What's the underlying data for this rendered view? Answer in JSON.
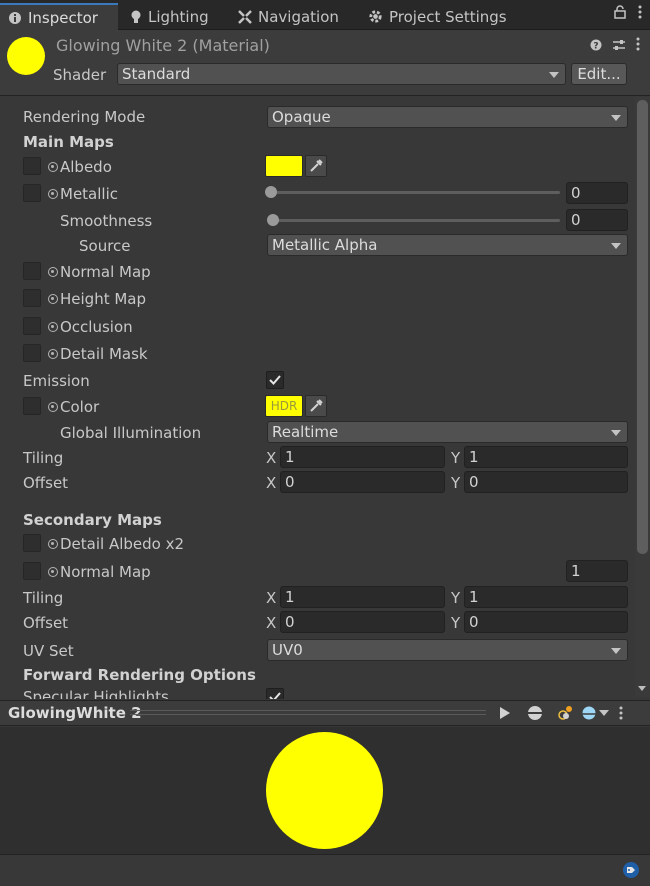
{
  "tabs": [
    {
      "label": "Inspector",
      "icon": "info-icon"
    },
    {
      "label": "Lighting",
      "icon": "bulb-icon"
    },
    {
      "label": "Navigation",
      "icon": "navigation-icon"
    },
    {
      "label": "Project Settings",
      "icon": "gear-icon"
    }
  ],
  "header": {
    "title": "Glowing White 2 (Material)",
    "shader_label": "Shader",
    "shader_value": "Standard",
    "edit_button": "Edit..."
  },
  "colors": {
    "albedo": "#ffff00",
    "emission": "#ffff00",
    "accent": "#3a79bb"
  },
  "props": {
    "rendering_mode_label": "Rendering Mode",
    "rendering_mode_value": "Opaque",
    "main_maps": "Main Maps",
    "albedo": "Albedo",
    "metallic": "Metallic",
    "metallic_value": "0",
    "smoothness": "Smoothness",
    "smoothness_value": "0",
    "source": "Source",
    "source_value": "Metallic Alpha",
    "normal_map": "Normal Map",
    "height_map": "Height Map",
    "occlusion": "Occlusion",
    "detail_mask": "Detail Mask",
    "emission": "Emission",
    "color": "Color",
    "hdr": "HDR",
    "global_illumination": "Global Illumination",
    "gi_value": "Realtime",
    "tiling": "Tiling",
    "tiling_x": "1",
    "tiling_y": "1",
    "offset": "Offset",
    "offset_x": "0",
    "offset_y": "0",
    "secondary_maps": "Secondary Maps",
    "detail_albedo": "Detail Albedo x2",
    "normal_map_2": "Normal Map",
    "normal_map_2_value": "1",
    "tiling_2": "Tiling",
    "tiling_2_x": "1",
    "tiling_2_y": "1",
    "offset_2": "Offset",
    "offset_2_x": "0",
    "offset_2_y": "0",
    "uv_set": "UV Set",
    "uv_set_value": "UV0",
    "forward_rendering": "Forward Rendering Options",
    "specular_highlights": "Specular Highlights",
    "x_label": "X",
    "y_label": "Y"
  },
  "preview": {
    "title": "GlowingWhite 2"
  }
}
